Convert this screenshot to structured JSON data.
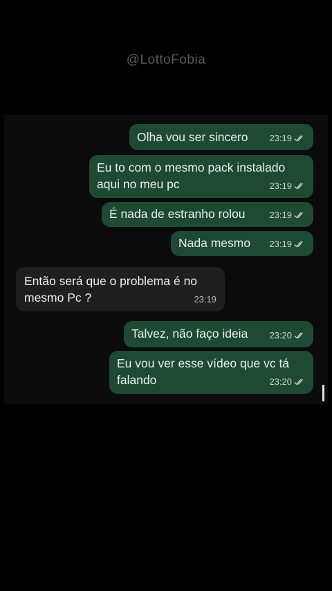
{
  "watermark": "@LottoFobia",
  "messages": [
    {
      "direction": "outgoing",
      "lines": [
        "Olha vou ser sincero"
      ],
      "time": "23:19",
      "status": "read"
    },
    {
      "direction": "outgoing",
      "lines": [
        "Eu to com o mesmo pack instalado",
        "aqui no meu pc"
      ],
      "time": "23:19",
      "status": "read"
    },
    {
      "direction": "outgoing",
      "lines": [
        "É nada de estranho rolou"
      ],
      "time": "23:19",
      "status": "read"
    },
    {
      "direction": "outgoing",
      "lines": [
        "Nada mesmo"
      ],
      "time": "23:19",
      "status": "read"
    },
    {
      "direction": "incoming",
      "lines": [
        "Então será que o problema é no",
        "mesmo Pc ?"
      ],
      "time": "23:19"
    },
    {
      "direction": "outgoing",
      "lines": [
        "Talvez, não faço ideia"
      ],
      "time": "23:20",
      "status": "read"
    },
    {
      "direction": "outgoing",
      "lines": [
        "Eu vou ver esse vídeo que vc tá",
        "falando"
      ],
      "time": "23:20",
      "status": "read"
    }
  ],
  "icons": {
    "read_receipt": "double-check-icon"
  },
  "colors": {
    "outgoing_bubble": "#1e4a34",
    "incoming_bubble": "#1f1f1f",
    "background": "#000000"
  }
}
